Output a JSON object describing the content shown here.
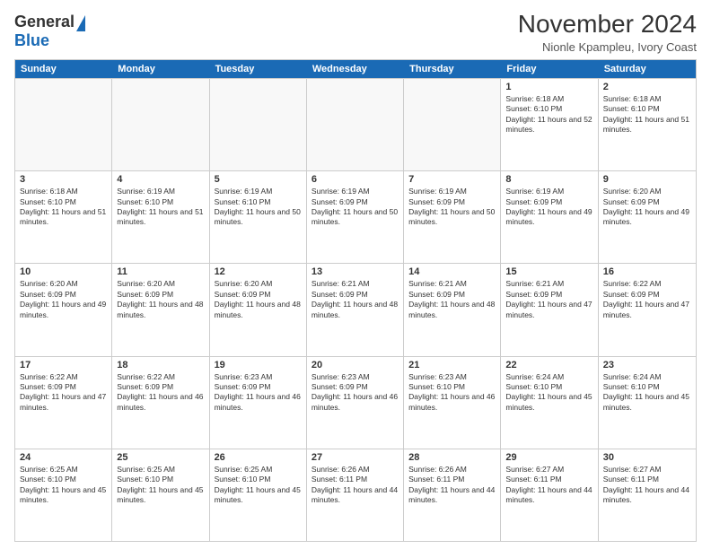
{
  "logo": {
    "general": "General",
    "blue": "Blue"
  },
  "title": "November 2024",
  "subtitle": "Nionle Kpampleu, Ivory Coast",
  "header_days": [
    "Sunday",
    "Monday",
    "Tuesday",
    "Wednesday",
    "Thursday",
    "Friday",
    "Saturday"
  ],
  "weeks": [
    [
      {
        "num": "",
        "empty": true
      },
      {
        "num": "",
        "empty": true
      },
      {
        "num": "",
        "empty": true
      },
      {
        "num": "",
        "empty": true
      },
      {
        "num": "",
        "empty": true
      },
      {
        "num": "1",
        "sunrise": "6:18 AM",
        "sunset": "6:10 PM",
        "daylight": "11 hours and 52 minutes."
      },
      {
        "num": "2",
        "sunrise": "6:18 AM",
        "sunset": "6:10 PM",
        "daylight": "11 hours and 51 minutes."
      }
    ],
    [
      {
        "num": "3",
        "sunrise": "6:18 AM",
        "sunset": "6:10 PM",
        "daylight": "11 hours and 51 minutes."
      },
      {
        "num": "4",
        "sunrise": "6:19 AM",
        "sunset": "6:10 PM",
        "daylight": "11 hours and 51 minutes."
      },
      {
        "num": "5",
        "sunrise": "6:19 AM",
        "sunset": "6:10 PM",
        "daylight": "11 hours and 50 minutes."
      },
      {
        "num": "6",
        "sunrise": "6:19 AM",
        "sunset": "6:09 PM",
        "daylight": "11 hours and 50 minutes."
      },
      {
        "num": "7",
        "sunrise": "6:19 AM",
        "sunset": "6:09 PM",
        "daylight": "11 hours and 50 minutes."
      },
      {
        "num": "8",
        "sunrise": "6:19 AM",
        "sunset": "6:09 PM",
        "daylight": "11 hours and 49 minutes."
      },
      {
        "num": "9",
        "sunrise": "6:20 AM",
        "sunset": "6:09 PM",
        "daylight": "11 hours and 49 minutes."
      }
    ],
    [
      {
        "num": "10",
        "sunrise": "6:20 AM",
        "sunset": "6:09 PM",
        "daylight": "11 hours and 49 minutes."
      },
      {
        "num": "11",
        "sunrise": "6:20 AM",
        "sunset": "6:09 PM",
        "daylight": "11 hours and 48 minutes."
      },
      {
        "num": "12",
        "sunrise": "6:20 AM",
        "sunset": "6:09 PM",
        "daylight": "11 hours and 48 minutes."
      },
      {
        "num": "13",
        "sunrise": "6:21 AM",
        "sunset": "6:09 PM",
        "daylight": "11 hours and 48 minutes."
      },
      {
        "num": "14",
        "sunrise": "6:21 AM",
        "sunset": "6:09 PM",
        "daylight": "11 hours and 48 minutes."
      },
      {
        "num": "15",
        "sunrise": "6:21 AM",
        "sunset": "6:09 PM",
        "daylight": "11 hours and 47 minutes."
      },
      {
        "num": "16",
        "sunrise": "6:22 AM",
        "sunset": "6:09 PM",
        "daylight": "11 hours and 47 minutes."
      }
    ],
    [
      {
        "num": "17",
        "sunrise": "6:22 AM",
        "sunset": "6:09 PM",
        "daylight": "11 hours and 47 minutes."
      },
      {
        "num": "18",
        "sunrise": "6:22 AM",
        "sunset": "6:09 PM",
        "daylight": "11 hours and 46 minutes."
      },
      {
        "num": "19",
        "sunrise": "6:23 AM",
        "sunset": "6:09 PM",
        "daylight": "11 hours and 46 minutes."
      },
      {
        "num": "20",
        "sunrise": "6:23 AM",
        "sunset": "6:09 PM",
        "daylight": "11 hours and 46 minutes."
      },
      {
        "num": "21",
        "sunrise": "6:23 AM",
        "sunset": "6:10 PM",
        "daylight": "11 hours and 46 minutes."
      },
      {
        "num": "22",
        "sunrise": "6:24 AM",
        "sunset": "6:10 PM",
        "daylight": "11 hours and 45 minutes."
      },
      {
        "num": "23",
        "sunrise": "6:24 AM",
        "sunset": "6:10 PM",
        "daylight": "11 hours and 45 minutes."
      }
    ],
    [
      {
        "num": "24",
        "sunrise": "6:25 AM",
        "sunset": "6:10 PM",
        "daylight": "11 hours and 45 minutes."
      },
      {
        "num": "25",
        "sunrise": "6:25 AM",
        "sunset": "6:10 PM",
        "daylight": "11 hours and 45 minutes."
      },
      {
        "num": "26",
        "sunrise": "6:25 AM",
        "sunset": "6:10 PM",
        "daylight": "11 hours and 45 minutes."
      },
      {
        "num": "27",
        "sunrise": "6:26 AM",
        "sunset": "6:11 PM",
        "daylight": "11 hours and 44 minutes."
      },
      {
        "num": "28",
        "sunrise": "6:26 AM",
        "sunset": "6:11 PM",
        "daylight": "11 hours and 44 minutes."
      },
      {
        "num": "29",
        "sunrise": "6:27 AM",
        "sunset": "6:11 PM",
        "daylight": "11 hours and 44 minutes."
      },
      {
        "num": "30",
        "sunrise": "6:27 AM",
        "sunset": "6:11 PM",
        "daylight": "11 hours and 44 minutes."
      }
    ]
  ]
}
